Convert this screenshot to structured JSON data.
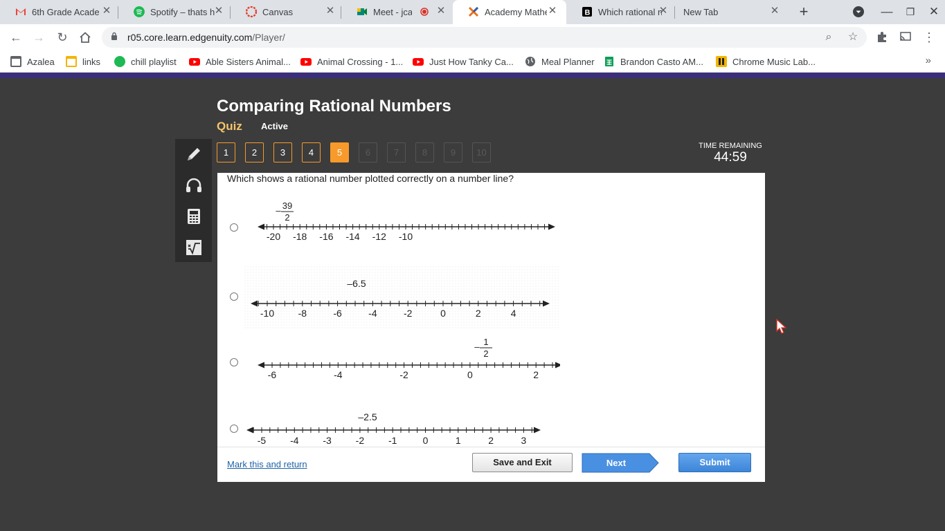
{
  "browser": {
    "tabs": [
      {
        "title": "6th Grade Acade",
        "icon": "gmail-icon",
        "color": "#ea4335"
      },
      {
        "title": "Spotify – thats h",
        "icon": "spotify-icon",
        "color": "#1db954"
      },
      {
        "title": "Canvas",
        "icon": "canvas-icon",
        "color": "#e13f2b"
      },
      {
        "title": "Meet - jca-dh",
        "icon": "meet-icon",
        "color": "#00897b"
      },
      {
        "title": "Academy Mathe",
        "icon": "edgenuity-icon",
        "color": "#e8711c"
      },
      {
        "title": "Which rational n",
        "icon": "brainly-icon",
        "color": "#000000"
      },
      {
        "title": "New Tab",
        "icon": "",
        "color": ""
      }
    ],
    "url_host": "r05.core.learn.edgenuity.com",
    "url_path": "/Player/",
    "bookmarks": [
      {
        "label": "Azalea",
        "icon": "folder-icon",
        "color": "#5f6368"
      },
      {
        "label": "links",
        "icon": "folder-icon",
        "color": "#f4b400"
      },
      {
        "label": "chill playlist",
        "icon": "spotify-icon",
        "color": "#1db954"
      },
      {
        "label": "Able Sisters Animal...",
        "icon": "youtube-icon",
        "color": "#ff0000"
      },
      {
        "label": "Animal Crossing - 1...",
        "icon": "youtube-icon",
        "color": "#ff0000"
      },
      {
        "label": "Just How Tanky Ca...",
        "icon": "youtube-icon",
        "color": "#ff0000"
      },
      {
        "label": "Meal Planner",
        "icon": "globe-icon",
        "color": "#5f6368"
      },
      {
        "label": "Brandon Casto AM...",
        "icon": "sheets-icon",
        "color": "#0f9d58"
      },
      {
        "label": "Chrome Music Lab...",
        "icon": "musiclab-icon",
        "color": "#f4b400"
      }
    ],
    "more_bookmarks": "»"
  },
  "page": {
    "title": "Comparing Rational Numbers",
    "type_label": "Quiz",
    "status": "Active",
    "questions": [
      "1",
      "2",
      "3",
      "4",
      "5",
      "6",
      "7",
      "8",
      "9",
      "10"
    ],
    "current_question": 5,
    "answered_through": 5,
    "time_label": "TIME REMAINING",
    "time_value": "44:59",
    "question_text": "Which shows a rational number plotted correctly on a number line?",
    "options": [
      {
        "ticks": [
          "-20",
          "-18",
          "-16",
          "-14",
          "-12",
          "-10"
        ],
        "point_label": "39/2",
        "point_sign": "–"
      },
      {
        "ticks": [
          "-10",
          "-8",
          "-6",
          "-4",
          "-2",
          "0",
          "2",
          "4"
        ],
        "point_label": "–6.5"
      },
      {
        "ticks": [
          "-6",
          "-4",
          "-2",
          "0",
          "2"
        ],
        "point_label": "1/2",
        "point_sign": "–"
      },
      {
        "ticks": [
          "-5",
          "-4",
          "-3",
          "-2",
          "-1",
          "0",
          "1",
          "2",
          "3"
        ],
        "point_label": "–2.5"
      }
    ],
    "mark_link": "Mark this and return",
    "save_button": "Save and Exit",
    "next_button": "Next",
    "submit_button": "Submit",
    "colors": {
      "accent": "#f79a2b",
      "header_bar": "#3b2f7a",
      "background": "#3c3c3c",
      "quiz_label": "#f5c56b",
      "button_blue": "#4a90e2"
    }
  }
}
